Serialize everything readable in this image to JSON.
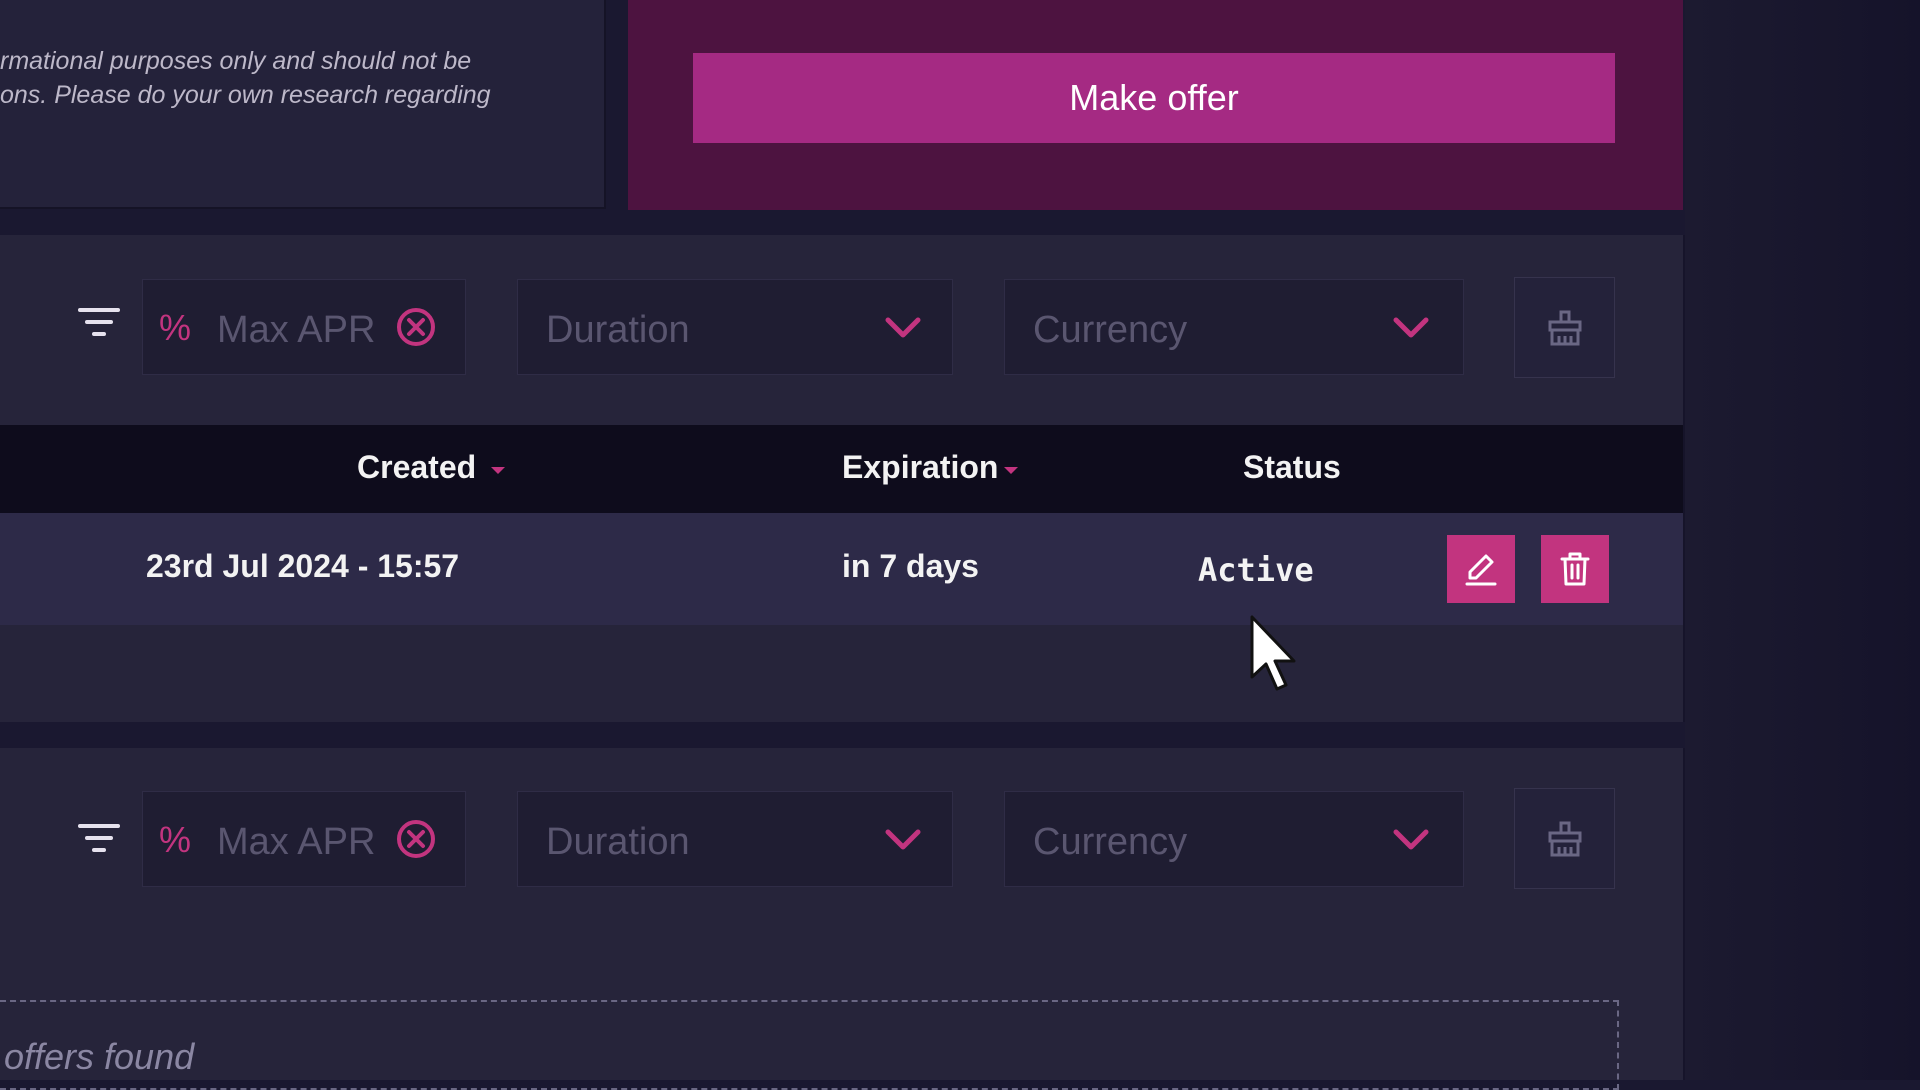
{
  "disclaimer": {
    "line1": "rmational purposes only and should not be",
    "line2": "ons. Please do your own research regarding"
  },
  "offer": {
    "make_offer_label": "Make offer"
  },
  "filters": {
    "percent_symbol": "%",
    "max_apr_placeholder": "Max APR",
    "duration_placeholder": "Duration",
    "currency_placeholder": "Currency"
  },
  "table": {
    "columns": [
      "Created",
      "Expiration",
      "Status"
    ],
    "rows": [
      {
        "created": "23rd Jul 2024 - 15:57",
        "expiration": "in 7 days",
        "status": "Active"
      }
    ]
  },
  "empty": {
    "message": "offers found"
  },
  "colors": {
    "accent": "#c2347f",
    "panel": "#4d1340",
    "background": "#1a1830"
  }
}
